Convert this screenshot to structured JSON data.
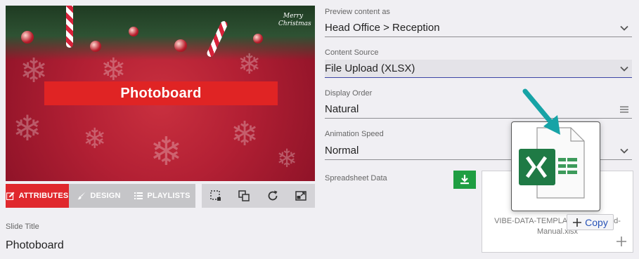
{
  "preview": {
    "title": "Photoboard",
    "badge": "Merry Christmas"
  },
  "tabs": [
    {
      "label": "ATTRIBUTES",
      "icon": "edit-icon",
      "active": true
    },
    {
      "label": "DESIGN",
      "icon": "brush-icon",
      "active": false
    },
    {
      "label": "PLAYLISTS",
      "icon": "list-icon",
      "active": false
    }
  ],
  "toolbar": {
    "icons": [
      "select-region-icon",
      "layers-icon",
      "refresh-icon",
      "fullscreen-icon"
    ]
  },
  "slide_title": {
    "label": "Slide Title",
    "value": "Photoboard"
  },
  "fields": {
    "preview_content": {
      "label": "Preview content as",
      "value": "Head Office > Reception"
    },
    "content_source": {
      "label": "Content Source",
      "value": "File Upload (XLSX)"
    },
    "display_order": {
      "label": "Display Order",
      "value": "Natural"
    },
    "animation_speed": {
      "label": "Animation Speed",
      "value": "Normal"
    }
  },
  "spreadsheet": {
    "label": "Spreadsheet Data",
    "file_name": "VIBE-DATA-TEMPLAT",
    "file_name_tail": "d-",
    "file_name_line2": "Manual.xlsx",
    "copy_label": "Copy",
    "ghost_icon": "excel-file-icon"
  },
  "colors": {
    "accent_red": "#e0282d",
    "download_green": "#1f9e42",
    "active_underline": "#3d45a6",
    "cursor_teal": "#17a3a6"
  }
}
